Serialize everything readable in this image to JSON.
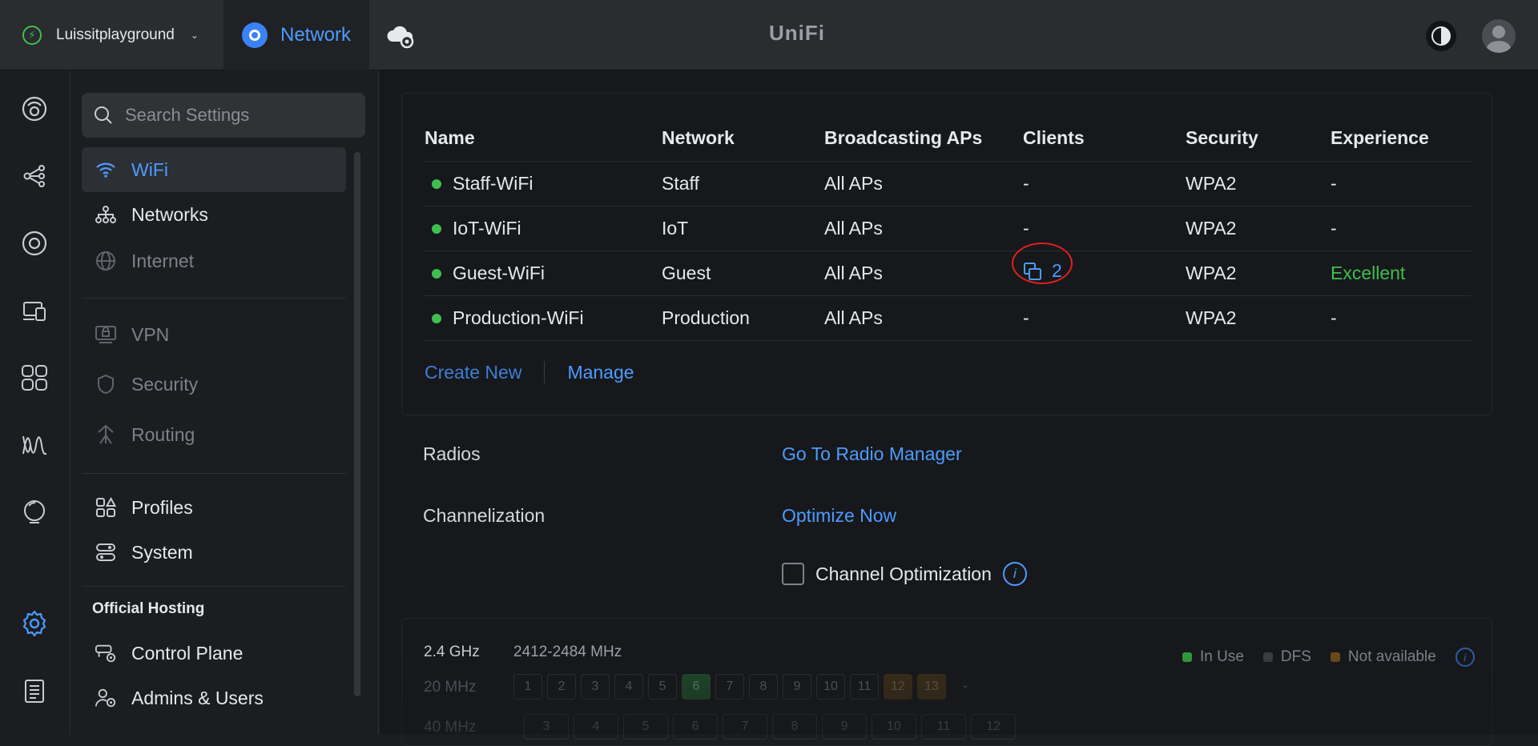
{
  "topbar": {
    "site_name": "Luissitplayground",
    "app_label": "Network",
    "brand": "UniFi"
  },
  "search": {
    "placeholder": "Search Settings"
  },
  "sidebar": {
    "items": [
      {
        "label": "WiFi",
        "icon": "wifi-icon",
        "state": "active"
      },
      {
        "label": "Networks",
        "icon": "network-tree-icon",
        "state": "normal"
      },
      {
        "label": "Internet",
        "icon": "globe-icon",
        "state": "dim"
      },
      {
        "label": "VPN",
        "icon": "vpn-icon",
        "state": "dim"
      },
      {
        "label": "Security",
        "icon": "shield-icon",
        "state": "dim"
      },
      {
        "label": "Routing",
        "icon": "routing-icon",
        "state": "dim"
      },
      {
        "label": "Profiles",
        "icon": "profiles-icon",
        "state": "normal"
      },
      {
        "label": "System",
        "icon": "system-icon",
        "state": "normal"
      }
    ],
    "section_title": "Official Hosting",
    "hosting_items": [
      {
        "label": "Control Plane",
        "icon": "control-plane-icon"
      },
      {
        "label": "Admins & Users",
        "icon": "admins-users-icon"
      }
    ]
  },
  "wifi_table": {
    "headers": [
      "Name",
      "Network",
      "Broadcasting APs",
      "Clients",
      "Security",
      "Experience"
    ],
    "rows": [
      {
        "name": "Staff-WiFi",
        "network": "Staff",
        "aps": "All APs",
        "clients": "-",
        "security": "WPA2",
        "experience": "-"
      },
      {
        "name": "IoT-WiFi",
        "network": "IoT",
        "aps": "All APs",
        "clients": "-",
        "security": "WPA2",
        "experience": "-"
      },
      {
        "name": "Guest-WiFi",
        "network": "Guest",
        "aps": "All APs",
        "clients": "2",
        "security": "WPA2",
        "experience": "Excellent"
      },
      {
        "name": "Production-WiFi",
        "network": "Production",
        "aps": "All APs",
        "clients": "-",
        "security": "WPA2",
        "experience": "-"
      }
    ],
    "create_new": "Create New",
    "manage": "Manage"
  },
  "radios": {
    "label": "Radios",
    "link": "Go To Radio Manager"
  },
  "channelization": {
    "label": "Channelization",
    "link": "Optimize Now",
    "checkbox_label": "Channel Optimization",
    "checked": false
  },
  "band": {
    "name": "2.4 GHz",
    "range": "2412-2484 MHz",
    "legend": [
      "In Use",
      "DFS",
      "Not available"
    ],
    "bw20": "20 MHz",
    "bw40": "40 MHz",
    "channels20": [
      "1",
      "2",
      "3",
      "4",
      "5",
      "6",
      "7",
      "8",
      "9",
      "10",
      "11",
      "12",
      "13",
      "-"
    ],
    "channels40": [
      "3",
      "4",
      "5",
      "6",
      "7",
      "8",
      "9",
      "10",
      "11",
      "12"
    ]
  },
  "colors": {
    "accent": "#4d9bff",
    "success": "#3fbf4f",
    "annotation": "#e0201c"
  }
}
